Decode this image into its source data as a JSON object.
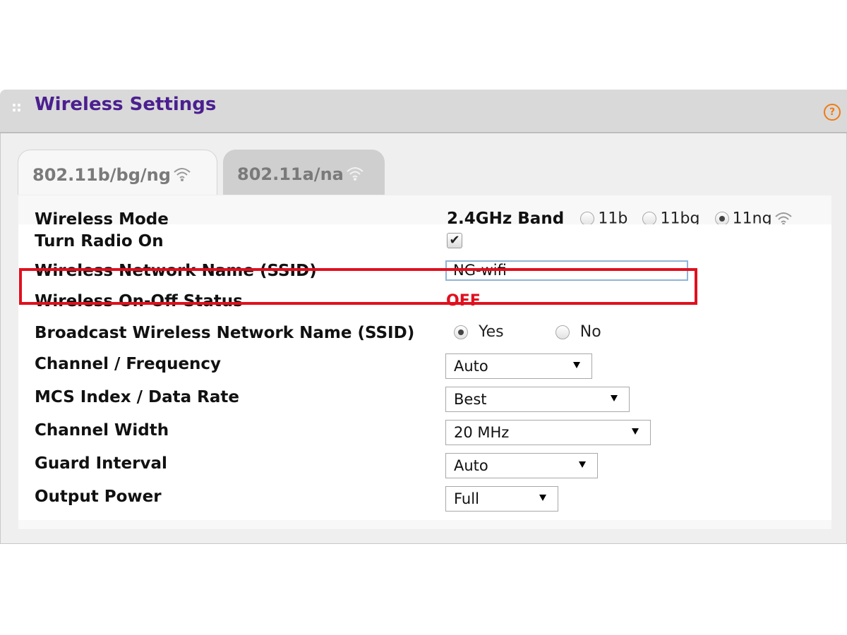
{
  "header": {
    "title": "Wireless Settings",
    "grip_glyph": "::",
    "help_glyph": "?"
  },
  "tabs": [
    {
      "label": "802.11b/bg/ng",
      "active": true
    },
    {
      "label": "802.11a/na",
      "active": false
    }
  ],
  "form": {
    "wireless_mode": {
      "label": "Wireless Mode",
      "band": "2.4GHz Band",
      "options": [
        "11b",
        "11bg",
        "11ng"
      ],
      "selected": "11ng"
    },
    "radio_on": {
      "label": "Turn Radio On",
      "checked": true,
      "check_glyph": "✔"
    },
    "ssid": {
      "label": "Wireless Network Name (SSID)",
      "value": "NG-wifi"
    },
    "status": {
      "label": "Wireless On-Off Status",
      "value": "OFF",
      "color": "#e0101e"
    },
    "broadcast": {
      "label": "Broadcast Wireless Network Name (SSID)",
      "yes": "Yes",
      "no": "No",
      "selected": "Yes"
    },
    "channel": {
      "label": "Channel / Frequency",
      "value": "Auto"
    },
    "mcs": {
      "label": "MCS Index / Data Rate",
      "value": "Best"
    },
    "width": {
      "label": "Channel Width",
      "value": "20 MHz"
    },
    "guard": {
      "label": "Guard Interval",
      "value": "Auto"
    },
    "power": {
      "label": "Output Power",
      "value": "Full"
    }
  },
  "annotation": {
    "highlight_color": "#e0101e"
  },
  "colors": {
    "title": "#4b1f8f",
    "help": "#f07b12",
    "input_border": "#8fb4d8"
  }
}
